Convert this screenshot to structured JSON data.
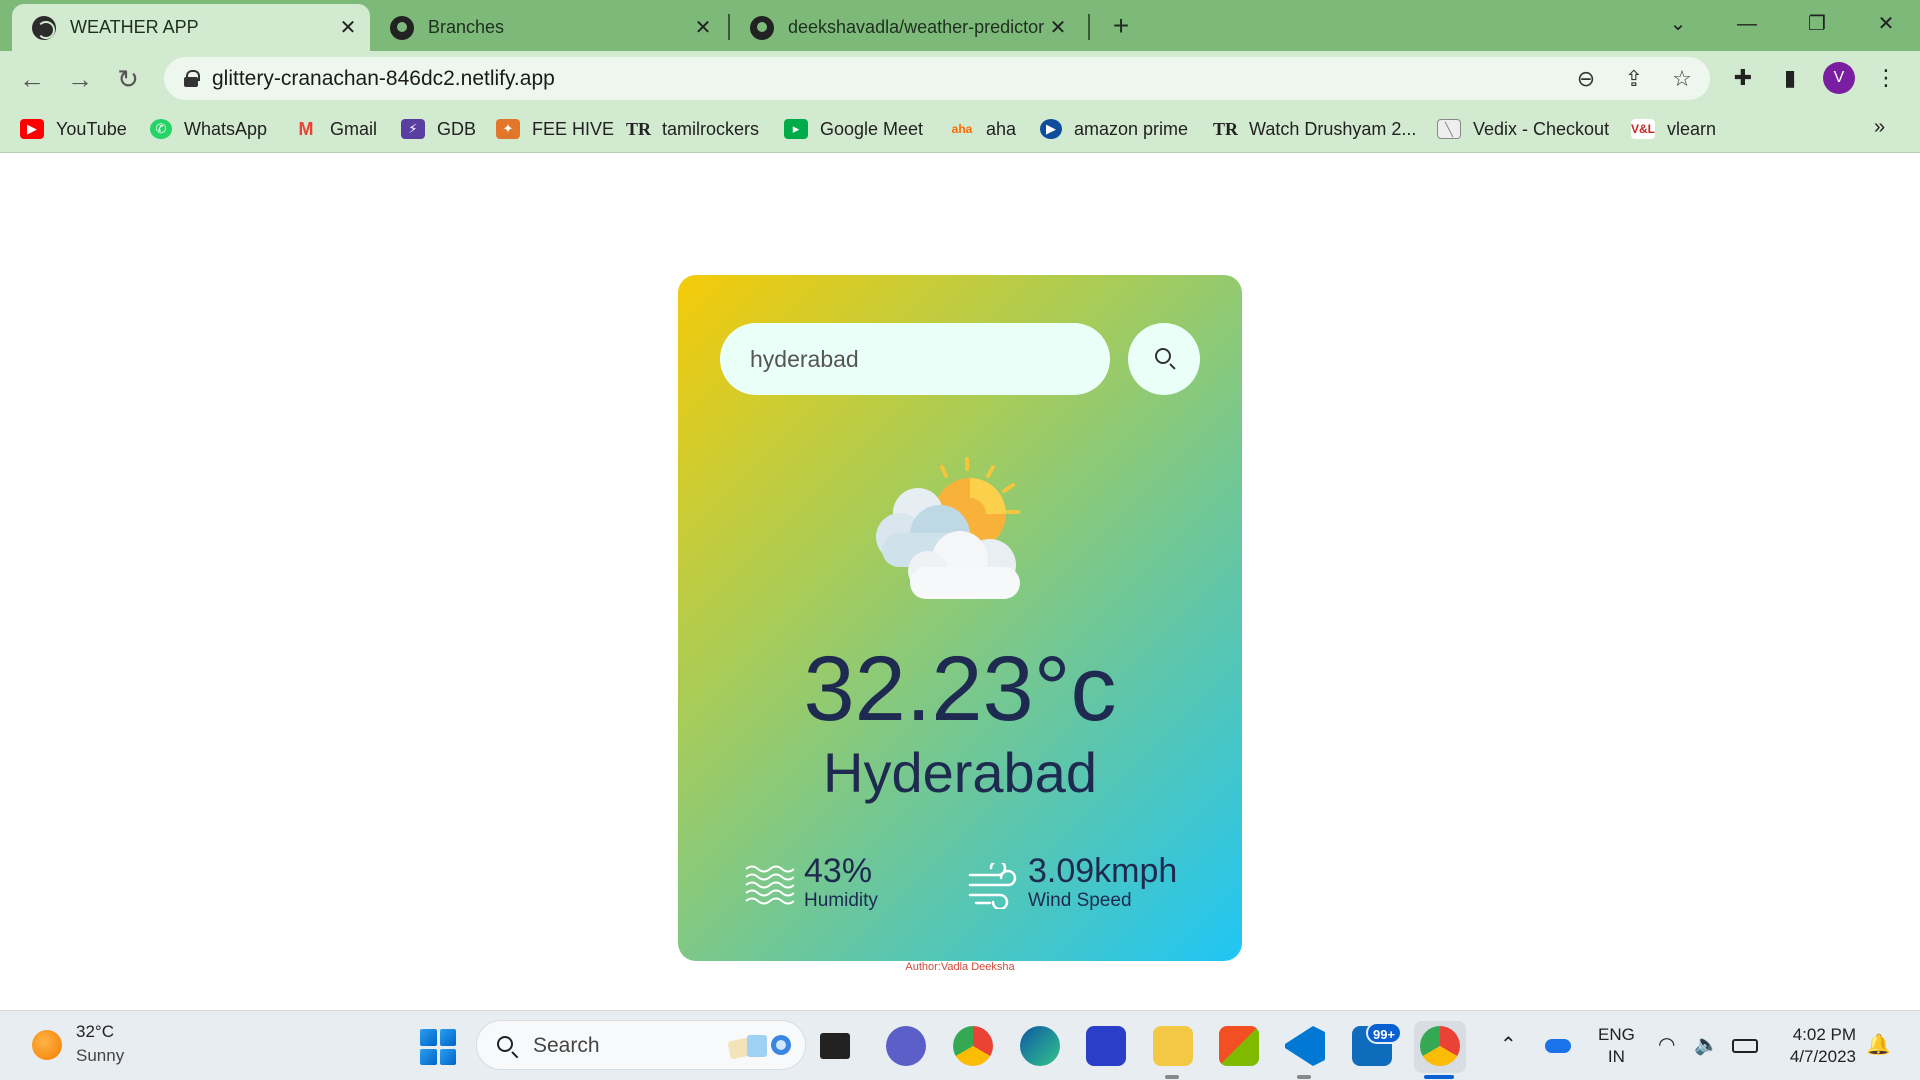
{
  "browser": {
    "tabs": [
      {
        "title": "WEATHER APP",
        "icon": "globe-icon",
        "active": true
      },
      {
        "title": "Branches",
        "icon": "github-icon",
        "active": false
      },
      {
        "title": "deekshavadla/weather-predictor",
        "icon": "github-icon",
        "active": false
      }
    ],
    "url": "glittery-cranachan-846dc2.netlify.app",
    "profile_initial": "V",
    "bookmarks": [
      {
        "label": "YouTube",
        "icon": "youtube-icon",
        "color": "#ff0000"
      },
      {
        "label": "WhatsApp",
        "icon": "whatsapp-icon",
        "color": "#25d366"
      },
      {
        "label": "Gmail",
        "icon": "gmail-icon",
        "color": "#ea4335"
      },
      {
        "label": "GDB",
        "icon": "gdb-icon",
        "color": "#5b3fa0"
      },
      {
        "label": "FEE HIVE",
        "icon": "feehive-icon",
        "color": "#e2762a"
      },
      {
        "label": "tamilrockers",
        "icon": "tr-icon",
        "color": "#222222"
      },
      {
        "label": "Google Meet",
        "icon": "google-meet-icon",
        "color": "#00ac47"
      },
      {
        "label": "aha",
        "icon": "aha-icon",
        "color": "#ff6a00"
      },
      {
        "label": "amazon prime",
        "icon": "prime-icon",
        "color": "#1a98ff"
      },
      {
        "label": "Watch Drushyam 2...",
        "icon": "tr-icon",
        "color": "#222222"
      },
      {
        "label": "Vedix - Checkout",
        "icon": "vedix-icon",
        "color": "#9e9e9e"
      },
      {
        "label": "vlearn",
        "icon": "vlearn-icon",
        "color": "#c62828"
      }
    ]
  },
  "weather": {
    "search_value": "hyderabad",
    "temperature": "32.23°c",
    "city": "Hyderabad",
    "humidity_value": "43%",
    "humidity_label": "Humidity",
    "wind_value": "3.09kmph",
    "wind_label": "Wind Speed",
    "author": "Author:Vadla Deeksha"
  },
  "taskbar": {
    "weather_temp": "32°C",
    "weather_condition": "Sunny",
    "search_label": "Search",
    "mail_badge": "99+",
    "lang_line1": "ENG",
    "lang_line2": "IN",
    "time": "4:02 PM",
    "date": "4/7/2023"
  },
  "colors": {
    "card_gradient_start": "#f5cb08",
    "card_gradient_end": "#1fc6f5",
    "text_dark": "#1e2a4f",
    "chrome_tabstrip": "#7dba7a",
    "chrome_toolbar": "#d2ead0"
  }
}
